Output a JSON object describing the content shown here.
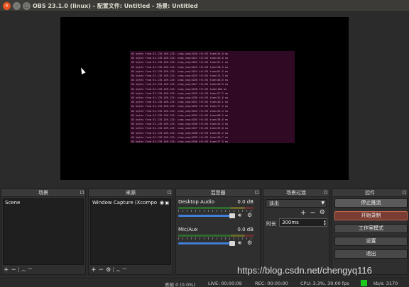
{
  "window": {
    "title": "OBS 23.1.0 (linux) - 配置文件: Untitled - 场景: Untitled"
  },
  "terminal": {
    "lines": [
      "64 bytes from 61.135.169.125: icmp_seq=1020 ttl=53 time=34.0 ms",
      "64 bytes from 61.135.169.125: icmp_seq=1021 ttl=53 time=36.0 ms",
      "64 bytes from 61.135.169.125: icmp_seq=1022 ttl=53 time=51.1 ms",
      "64 bytes from 61.135.169.125: icmp_seq=1023 ttl=53 time=38.9 ms",
      "64 bytes from 61.135.169.125: icmp_seq=1024 ttl=53 time=61.5 ms",
      "64 bytes from 61.135.169.125: icmp_seq=1025 ttl=53 time=74.3 ms",
      "64 bytes from 61.135.169.125: icmp_seq=1026 ttl=53 time=48.6 ms",
      "64 bytes from 61.135.169.125: icmp_seq=1027 ttl=53 time=38.9 ms",
      "64 bytes from 61.135.169.125: icmp_seq=1028 ttl=53 time=100 ms",
      "64 bytes from 61.135.169.125: icmp_seq=1029 ttl=53 time=37.2 ms",
      "64 bytes from 61.135.169.125: icmp_seq=1030 ttl=53 time=32.6 ms",
      "64 bytes from 61.135.169.125: icmp_seq=1031 ttl=53 time=46.1 ms",
      "64 bytes from 61.135.169.125: icmp_seq=1032 ttl=53 time=77.5 ms",
      "64 bytes from 61.135.169.125: icmp_seq=1033 ttl=53 time=33.4 ms",
      "64 bytes from 61.135.169.125: icmp_seq=1034 ttl=53 time=88.5 ms",
      "64 bytes from 61.135.169.125: icmp_seq=1035 ttl=53 time=38.0 ms",
      "64 bytes from 61.135.169.125: icmp_seq=1036 ttl=53 time=34.5 ms",
      "64 bytes from 61.135.169.125: icmp_seq=1037 ttl=53 time=33.8 ms",
      "64 bytes from 61.135.169.125: icmp_seq=1038 ttl=53 time=55.2 ms",
      "64 bytes from 61.135.169.125: icmp_seq=1039 ttl=53 time=36.7 ms",
      "64 bytes from 61.135.169.125: icmp_seq=1040 ttl=53 time=27.5 ms",
      "64 bytes from 61.135.169.125: icmp_seq=1041 ttl=53 time=36.5 ms",
      "64 bytes from 61.135.169.125: icmp_seq=1042 ttl=53 time=56.6 ms"
    ]
  },
  "panels": {
    "scenes": {
      "title": "场景",
      "items": [
        "Scene"
      ]
    },
    "sources": {
      "title": "来源",
      "items": [
        "Window Capture (Xcompo"
      ]
    },
    "mixer": {
      "title": "混音器",
      "channels": [
        {
          "name": "Desktop Audio",
          "db": "0.0 dB",
          "volume": 1.0
        },
        {
          "name": "Mic/Aux",
          "db": "0.0 dB",
          "volume": 1.0
        }
      ]
    },
    "transitions": {
      "title": "场景过渡",
      "selected": "淡出",
      "duration_label": "时长",
      "duration_value": "300ms"
    },
    "controls": {
      "title": "控件",
      "buttons": [
        "停止推流",
        "开始录制",
        "工作室模式",
        "设置",
        "退出"
      ]
    }
  },
  "toolbar_glyphs": {
    "add": "+",
    "remove": "−",
    "up": "︿",
    "down": "﹀",
    "gear": "⚙"
  },
  "status": {
    "dropped": "丢帧 0 (0.0%)",
    "live": "LIVE: 00:00:09",
    "rec": "REC: 00:00:00",
    "cpu": "CPU: 3.3%, 30.00 fps",
    "kbps": "kb/s: 3170",
    "indicator_color": "#1ec81e"
  },
  "watermark": "https://blog.csdn.net/chengyq116",
  "colors": {
    "accent_close": "#e95420",
    "terminal_bg": "#300a24",
    "slider": "#3f7fd6"
  }
}
